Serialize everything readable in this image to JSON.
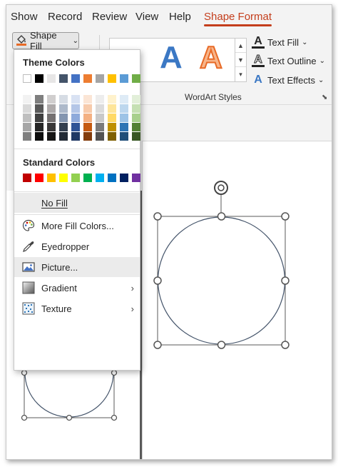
{
  "tabs": [
    "Show",
    "Record",
    "Review",
    "View",
    "Help",
    "Shape Format"
  ],
  "active_tab": "Shape Format",
  "ribbon": {
    "shape_fill_label": "Shape Fill",
    "wordart_letter": "A",
    "text_fill_label": "Text Fill",
    "text_outline_label": "Text Outline",
    "text_effects_label": "Text Effects",
    "group_label": "WordArt Styles"
  },
  "dropdown": {
    "theme_colors_label": "Theme Colors",
    "standard_colors_label": "Standard Colors",
    "theme_colors": [
      "#ffffff",
      "#000000",
      "#e7e6e6",
      "#44546a",
      "#4472c4",
      "#ed7d31",
      "#a5a5a5",
      "#ffc000",
      "#5b9bd5",
      "#70ad47"
    ],
    "theme_shades": [
      [
        "#f2f2f2",
        "#d9d9d9",
        "#bfbfbf",
        "#a6a6a6",
        "#7f7f7f"
      ],
      [
        "#7f7f7f",
        "#595959",
        "#404040",
        "#262626",
        "#0d0d0d"
      ],
      [
        "#d0cece",
        "#aeaaaa",
        "#757171",
        "#3a3838",
        "#171616"
      ],
      [
        "#d6dce4",
        "#adb9ca",
        "#8496b0",
        "#333f4f",
        "#222a35"
      ],
      [
        "#d9e2f3",
        "#b4c6e7",
        "#8eaadb",
        "#2f5496",
        "#1f3864"
      ],
      [
        "#fbe5d5",
        "#f7cbac",
        "#f4b183",
        "#c55a11",
        "#833c0b"
      ],
      [
        "#ededed",
        "#dbdbdb",
        "#c9c9c9",
        "#7b7b7b",
        "#525252"
      ],
      [
        "#fff2cc",
        "#fee599",
        "#ffd965",
        "#bf9000",
        "#7f6000"
      ],
      [
        "#deebf6",
        "#bdd7ee",
        "#9dc3e6",
        "#2e75b5",
        "#1f4e79"
      ],
      [
        "#e2efd9",
        "#c5e0b3",
        "#a8d08d",
        "#538135",
        "#375623"
      ]
    ],
    "standard_colors": [
      "#c00000",
      "#ff0000",
      "#ffc000",
      "#ffff00",
      "#92d050",
      "#00b050",
      "#00b0f0",
      "#0070c0",
      "#002060",
      "#7030a0"
    ],
    "menu_items": [
      {
        "label": "No Fill",
        "icon": "no-fill-icon",
        "submenu": false
      },
      {
        "label": "More Fill Colors...",
        "icon": "palette-icon",
        "submenu": false
      },
      {
        "label": "Eyedropper",
        "icon": "eyedropper-icon",
        "submenu": false
      },
      {
        "label": "Picture...",
        "icon": "picture-icon",
        "submenu": false
      },
      {
        "label": "Gradient",
        "icon": "gradient-icon",
        "submenu": true
      },
      {
        "label": "Texture",
        "icon": "texture-icon",
        "submenu": true
      }
    ]
  },
  "colors": {
    "accent_tab": "#c43e1c",
    "shape_outline": "#44546a",
    "handle_stroke": "#5a5a5a"
  }
}
